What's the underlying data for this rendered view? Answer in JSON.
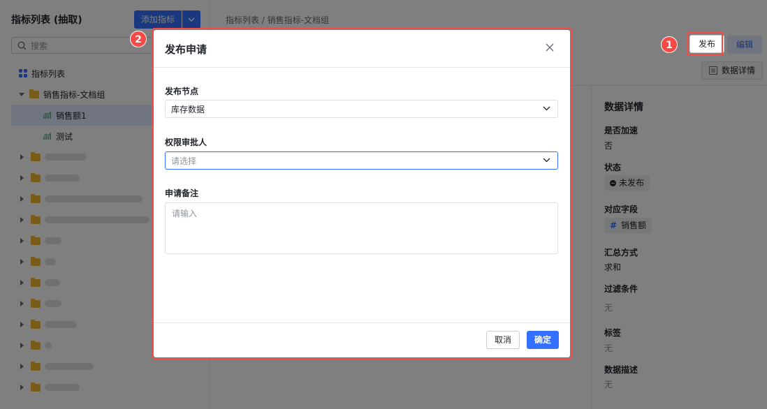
{
  "sidebar": {
    "title": "指标列表 (抽取)",
    "add_button": "添加指标",
    "search_placeholder": "搜索",
    "tree": {
      "root_label": "指标列表",
      "group_label": "销售指标-文档组",
      "items": [
        "销售额1",
        "测试"
      ]
    }
  },
  "main": {
    "breadcrumb": "指标列表 / 销售指标-文档组",
    "publish_button": "发布",
    "edit_button": "编辑",
    "detail_button": "数据详情"
  },
  "detail": {
    "title": "数据详情",
    "accelerate_label": "是否加速",
    "accelerate_value": "否",
    "status_label": "状态",
    "status_value": "未发布",
    "field_label": "对应字段",
    "field_value": "销售额",
    "agg_label": "汇总方式",
    "agg_value": "求和",
    "filter_label": "过滤条件",
    "filter_value": "无",
    "tag_label": "标签",
    "tag_value": "无",
    "desc_label": "数据描述",
    "desc_value": "无"
  },
  "badges": [
    "1",
    "2"
  ],
  "modal": {
    "title": "发布申请",
    "node_label": "发布节点",
    "node_value": "库存数据",
    "approver_label": "权限审批人",
    "approver_placeholder": "请选择",
    "remark_label": "申请备注",
    "remark_placeholder": "请输入",
    "cancel": "取消",
    "confirm": "确定"
  },
  "colors": {
    "accent": "#3370ff",
    "highlight": "#f54a45",
    "folder": "#f5b833"
  }
}
